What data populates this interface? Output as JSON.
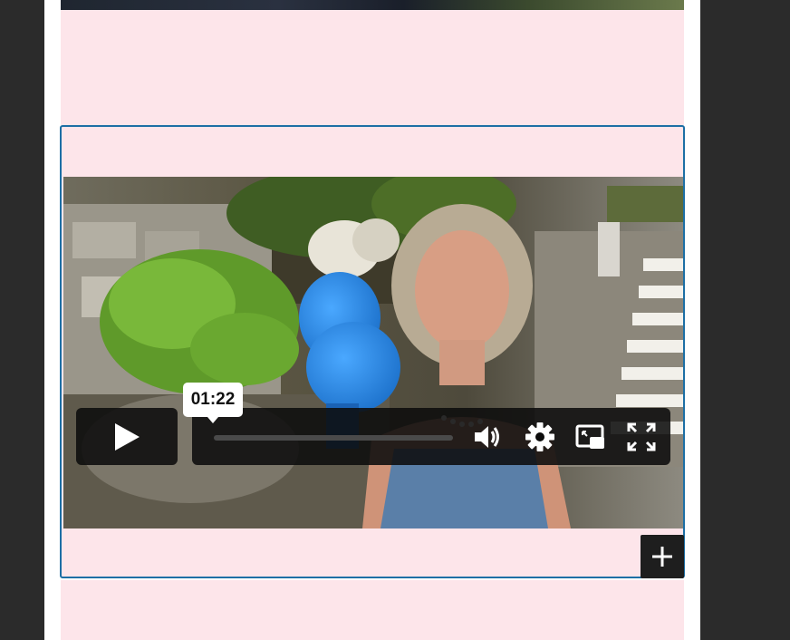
{
  "video": {
    "current_time_tooltip": "01:22",
    "progress_fraction": 0.0,
    "controls": {
      "play_icon": "play-icon",
      "volume_icon": "volume-icon",
      "settings_icon": "gear-icon",
      "pip_icon": "picture-in-picture-icon",
      "fullscreen_icon": "fullscreen-icon"
    }
  },
  "editor": {
    "add_block_icon": "plus-icon",
    "selected_block_border_color": "#1d6fa5",
    "block_background_color": "#fde5ea"
  }
}
